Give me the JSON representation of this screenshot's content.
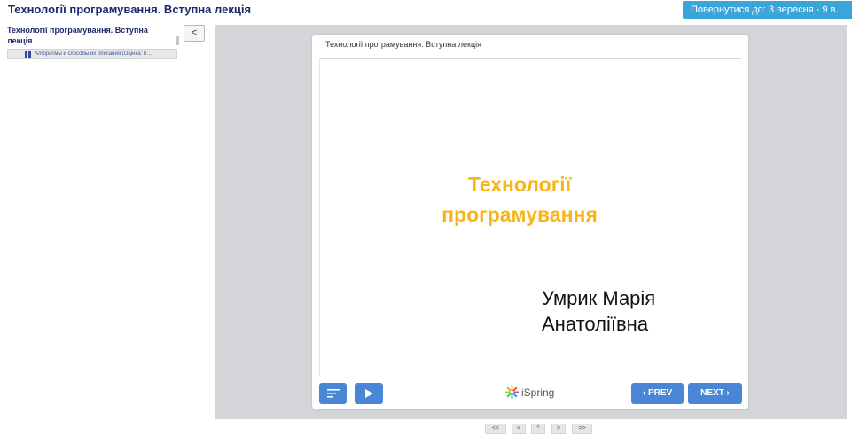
{
  "header": {
    "page_title": "Технології програмування. Вступна лекція",
    "return_label": "Повернутися до: 3 вересня - 9 в…",
    "return_arrow": "◂"
  },
  "sidebar": {
    "toc_title": "Технології програмування. Вступна лекція",
    "items": [
      {
        "label": "Алгоритмы и способы их описания (Оцінка: 8…"
      }
    ],
    "collapse_label": "<"
  },
  "player": {
    "title": "Технології програмування. Вступна лекція",
    "slide": {
      "heading_line1": "Технології",
      "heading_line2": "програмування",
      "author_line1": "Умрик Марія",
      "author_line2": "Анатоліївна",
      "heading_color": "#f7b51a"
    },
    "controls": {
      "prev_label": "PREV",
      "next_label": "NEXT",
      "brand": "iSpring",
      "accent": "#4a86d6"
    }
  },
  "pager": {
    "first": "<<",
    "prev": "<",
    "up": "^",
    "next": ">",
    "last": ">>"
  }
}
